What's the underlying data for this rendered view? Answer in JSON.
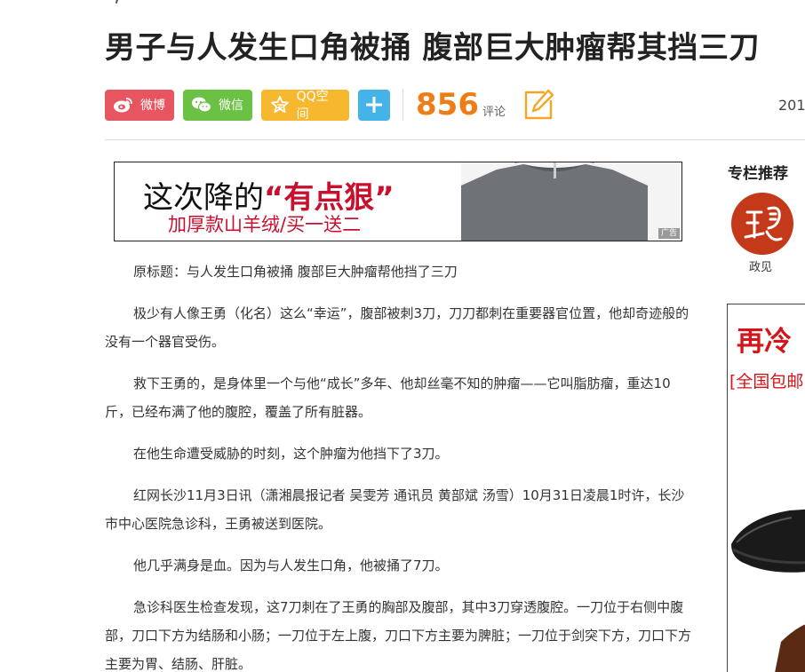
{
  "article": {
    "title": "男子与人发生口角被捅 腹部巨大肿瘤帮其挡三刀",
    "date": "201",
    "paragraphs": [
      "原标题：与人发生口角被捅 腹部巨大肿瘤帮他挡了三刀",
      "极少有人像王勇（化名）这么“幸运”，腹部被刺3刀，刀刀都刺在重要器官位置，他却奇迹般的没有一个器官受伤。",
      "救下王勇的，是身体里一个与他“成长”多年、他却丝毫不知的肿瘤——它叫脂肪瘤，重达10斤，已经布满了他的腹腔，覆盖了所有脏器。",
      "在他生命遭受威胁的时刻，这个肿瘤为他挡下了3刀。",
      "红网长沙11月3日讯（潇湘晨报记者 吴雯芳 通讯员 黄部斌 汤雪）10月31日凌晨1时许，长沙市中心医院急诊科，王勇被送到医院。",
      "他几乎满身是血。因为与人发生口角，他被捅了7刀。",
      "急诊科医生检查发现，这7刀刺在了王勇的胸部及腹部，其中3刀穿透腹腔。一刀位于右侧中腹部，刀口下方为结肠和小肠；一刀位于左上腹，刀口下方主要为脾脏；一刀位于剑突下方，刀口下方主要为胃、结肠、肝脏。"
    ]
  },
  "share": {
    "weibo": "微博",
    "weixin": "微信",
    "qzone": "QQ空间",
    "plus_icon": "plus-icon",
    "comment_count": "856",
    "comment_label": "评论",
    "edit_icon": "pencil-icon"
  },
  "ad_banner": {
    "headline": "这次降的",
    "highlight": "“有点狠”",
    "subline": "加厚款山羊绒/买一送二",
    "tag": "广告"
  },
  "sidebar": {
    "column_title": "专栏推荐",
    "column_name": "政见",
    "ad_headline": "再冷",
    "ad_subline": "[全国包邮"
  },
  "colors": {
    "weibo": "#e75560",
    "weixin": "#6ac144",
    "qzone": "#f5b82e",
    "plus": "#44b4e8",
    "comment_count": "#f07c15",
    "ad_red": "#c8102e"
  }
}
